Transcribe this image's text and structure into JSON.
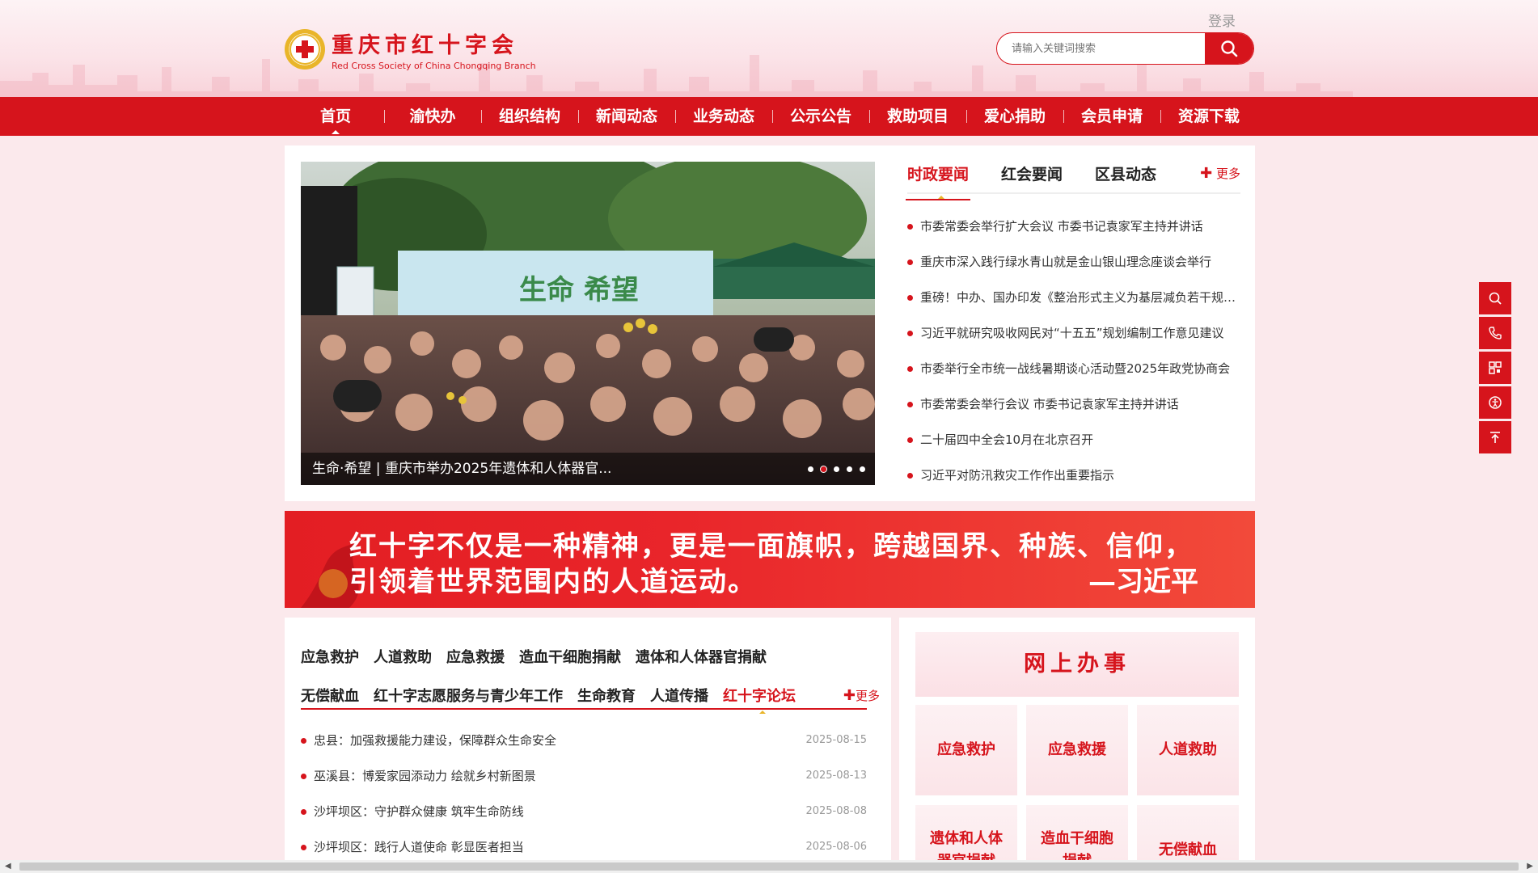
{
  "header": {
    "logo_cn": "重庆市红十字会",
    "logo_en": "Red Cross Society of China Chongqing Branch",
    "login": "登录",
    "search_placeholder": "请输入关键词搜索",
    "search_icon": "search-icon"
  },
  "nav": [
    "首页",
    "渝快办",
    "组织结构",
    "新闻动态",
    "业务动态",
    "公示公告",
    "救助项目",
    "爱心捐助",
    "会员申请",
    "资源下载"
  ],
  "slider": {
    "caption": "生命·希望 | 重庆市举办2025年遗体和人体器官...",
    "sign_text": "生命 希望",
    "dots": 5,
    "active_dot": 1
  },
  "news_tabs": [
    "时政要闻",
    "红会要闻",
    "区县动态"
  ],
  "more": "更多",
  "news": [
    "市委常委会举行扩大会议 市委书记袁家军主持并讲话",
    "重庆市深入践行绿水青山就是金山银山理念座谈会举行",
    "重磅！中办、国办印发《整治形式主义为基层减负若干规定》",
    "习近平就研究吸收网民对“十五五”规划编制工作意见建议",
    "市委举行全市统一战线暑期谈心活动暨2025年政党协商会",
    "市委常委会举行会议 市委书记袁家军主持并讲话",
    "二十届四中全会10月在北京召开",
    "习近平对防汛救灾工作作出重要指示"
  ],
  "banner": {
    "line1": "红十字不仅是一种精神，更是一面旗帜，跨越国界、种族、信仰，",
    "line2": "引领着世界范围内的人道运动。",
    "signature": "—习近平"
  },
  "categories_row1": [
    "应急救护",
    "人道救助",
    "应急救援",
    "造血干细胞捐献",
    "遗体和人体器官捐献"
  ],
  "categories_row2": [
    "无偿献血",
    "红十字志愿服务与青少年工作",
    "生命教育",
    "人道传播",
    "红十字论坛"
  ],
  "category_active": "红十字论坛",
  "articles": [
    {
      "title": "忠县：加强救援能力建设，保障群众生命安全",
      "date": "2025-08-15"
    },
    {
      "title": "巫溪县：博爱家园添动力 绘就乡村新图景",
      "date": "2025-08-13"
    },
    {
      "title": "沙坪坝区：守护群众健康 筑牢生命防线",
      "date": "2025-08-08"
    },
    {
      "title": "沙坪坝区：践行人道使命 彰显医者担当",
      "date": "2025-08-06"
    }
  ],
  "online": {
    "title": "网上办事",
    "services": [
      "应急救护",
      "应急救援",
      "人道救助",
      "遗体和人体器官捐献",
      "造血干细胞捐献",
      "无偿献血"
    ]
  },
  "side_tools": [
    "search-icon",
    "phone-icon",
    "qrcode-icon",
    "accessibility-icon",
    "back-to-top-icon"
  ],
  "colors": {
    "brand_red": "#d6141c",
    "gold": "#e9b52a",
    "page_bg": "#fbe9ec"
  }
}
